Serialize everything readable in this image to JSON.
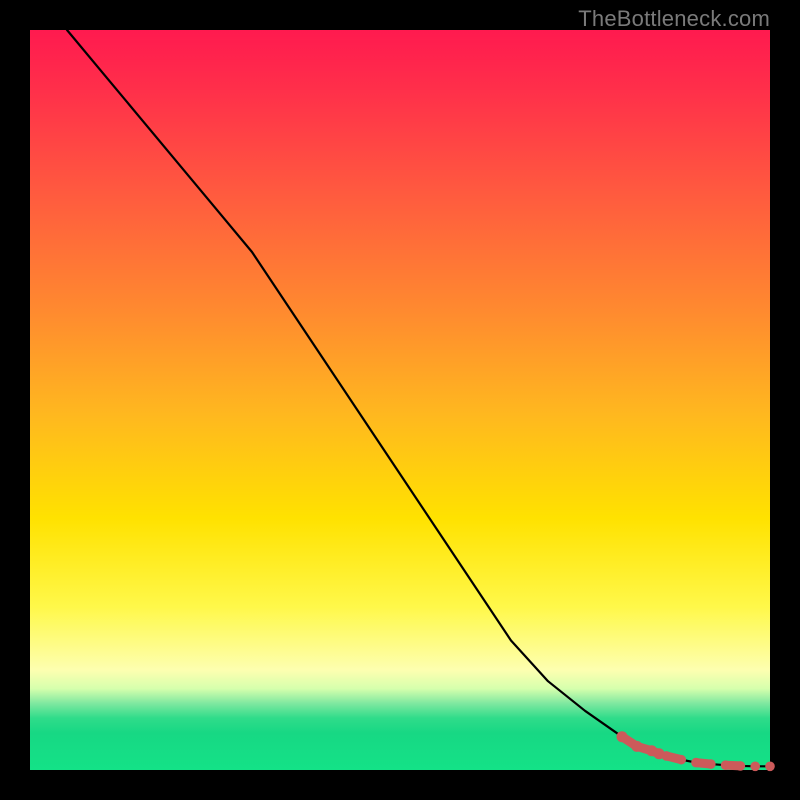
{
  "attribution": "TheBottleneck.com",
  "colors": {
    "line": "#000000",
    "marker": "#cc5a5a",
    "gradient_top": "#ff1a4f",
    "gradient_mid": "#ffe200",
    "gradient_bottom": "#14e287"
  },
  "chart_data": {
    "type": "line",
    "title": "",
    "xlabel": "",
    "ylabel": "",
    "xlim": [
      0,
      100
    ],
    "ylim": [
      0,
      100
    ],
    "series": [
      {
        "name": "bottleneck-curve",
        "style": "solid-black",
        "x": [
          5,
          10,
          15,
          20,
          25,
          30,
          35,
          40,
          45,
          50,
          55,
          60,
          65,
          70,
          75,
          80,
          82,
          85,
          88,
          90,
          92,
          94,
          96,
          98,
          100
        ],
        "y": [
          100,
          94,
          88,
          82,
          76,
          70,
          62.5,
          55,
          47.5,
          40,
          32.5,
          25,
          17.5,
          12,
          8,
          4.5,
          3.2,
          2.2,
          1.4,
          1.0,
          0.8,
          0.65,
          0.55,
          0.5,
          0.5
        ]
      },
      {
        "name": "highlighted-range",
        "style": "thick-dashed-marker",
        "note": "thick salmon dashed segment + scattered dots along the tail",
        "x": [
          80,
          82,
          84,
          85,
          86,
          88,
          90,
          92,
          94,
          96,
          98,
          100
        ],
        "y": [
          4.5,
          3.2,
          2.6,
          2.2,
          1.9,
          1.4,
          1.0,
          0.8,
          0.65,
          0.55,
          0.5,
          0.5
        ]
      }
    ]
  }
}
